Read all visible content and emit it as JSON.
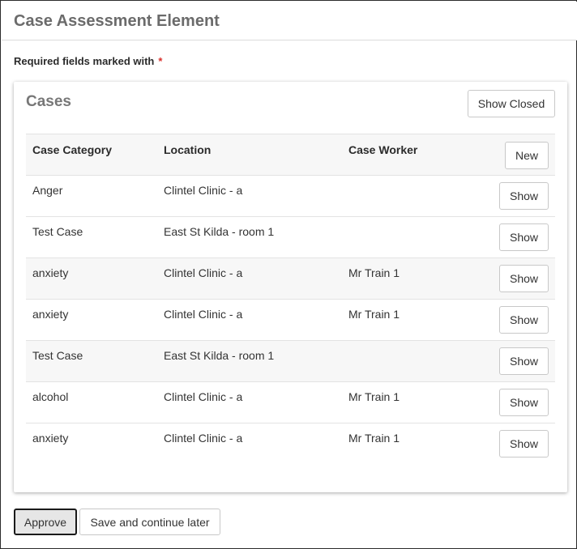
{
  "header": {
    "title": "Case Assessment Element"
  },
  "required_note": {
    "text": "Required fields marked with",
    "marker": "*"
  },
  "panel": {
    "title": "Cases",
    "show_closed_label": "Show Closed",
    "new_label": "New",
    "columns": [
      "Case Category",
      "Location",
      "Case Worker"
    ],
    "row_action_label": "Show",
    "rows": [
      {
        "category": "Anger",
        "location": "Clintel Clinic - a",
        "worker": ""
      },
      {
        "category": "Test Case",
        "location": "East St Kilda - room 1",
        "worker": ""
      },
      {
        "category": "anxiety",
        "location": "Clintel Clinic - a",
        "worker": "Mr Train 1"
      },
      {
        "category": "anxiety",
        "location": "Clintel Clinic - a",
        "worker": "Mr Train 1"
      },
      {
        "category": "Test Case",
        "location": "East St Kilda - room 1",
        "worker": ""
      },
      {
        "category": "alcohol",
        "location": "Clintel Clinic - a",
        "worker": "Mr Train 1"
      },
      {
        "category": "anxiety",
        "location": "Clintel Clinic - a",
        "worker": "Mr Train 1"
      }
    ]
  },
  "footer": {
    "approve_label": "Approve",
    "save_later_label": "Save and continue later"
  },
  "colors": {
    "required_marker": "#d9302c",
    "header_text": "#6b6b6b",
    "row_alt_bg": "#f7f7f7"
  }
}
